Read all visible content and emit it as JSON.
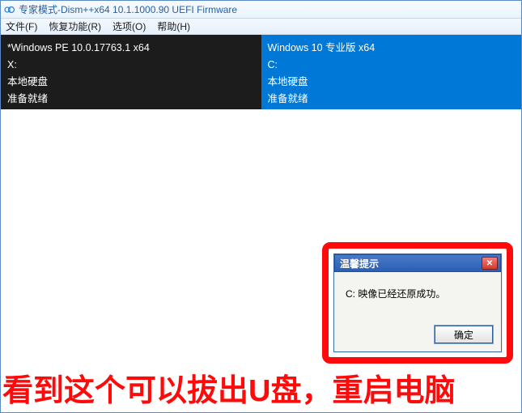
{
  "window": {
    "title": "专家模式-Dism++x64 10.1.1000.90 UEFI Firmware"
  },
  "menu": {
    "file": "文件(F)",
    "recovery": "恢复功能(R)",
    "options": "选项(O)",
    "help": "帮助(H)"
  },
  "panels": {
    "left": {
      "line1": "*Windows PE 10.0.17763.1 x64",
      "line2": "X:",
      "line3": "本地硬盘",
      "line4": "准备就绪"
    },
    "right": {
      "line1": "Windows 10 专业版 x64",
      "line2": "C:",
      "line3": "本地硬盘",
      "line4": "准备就绪"
    }
  },
  "dialog": {
    "title": "温馨提示",
    "message": "C: 映像已经还原成功。",
    "ok_label": "确定"
  },
  "annotation": {
    "text": "看到这个可以拔出U盘，重启电脑"
  }
}
